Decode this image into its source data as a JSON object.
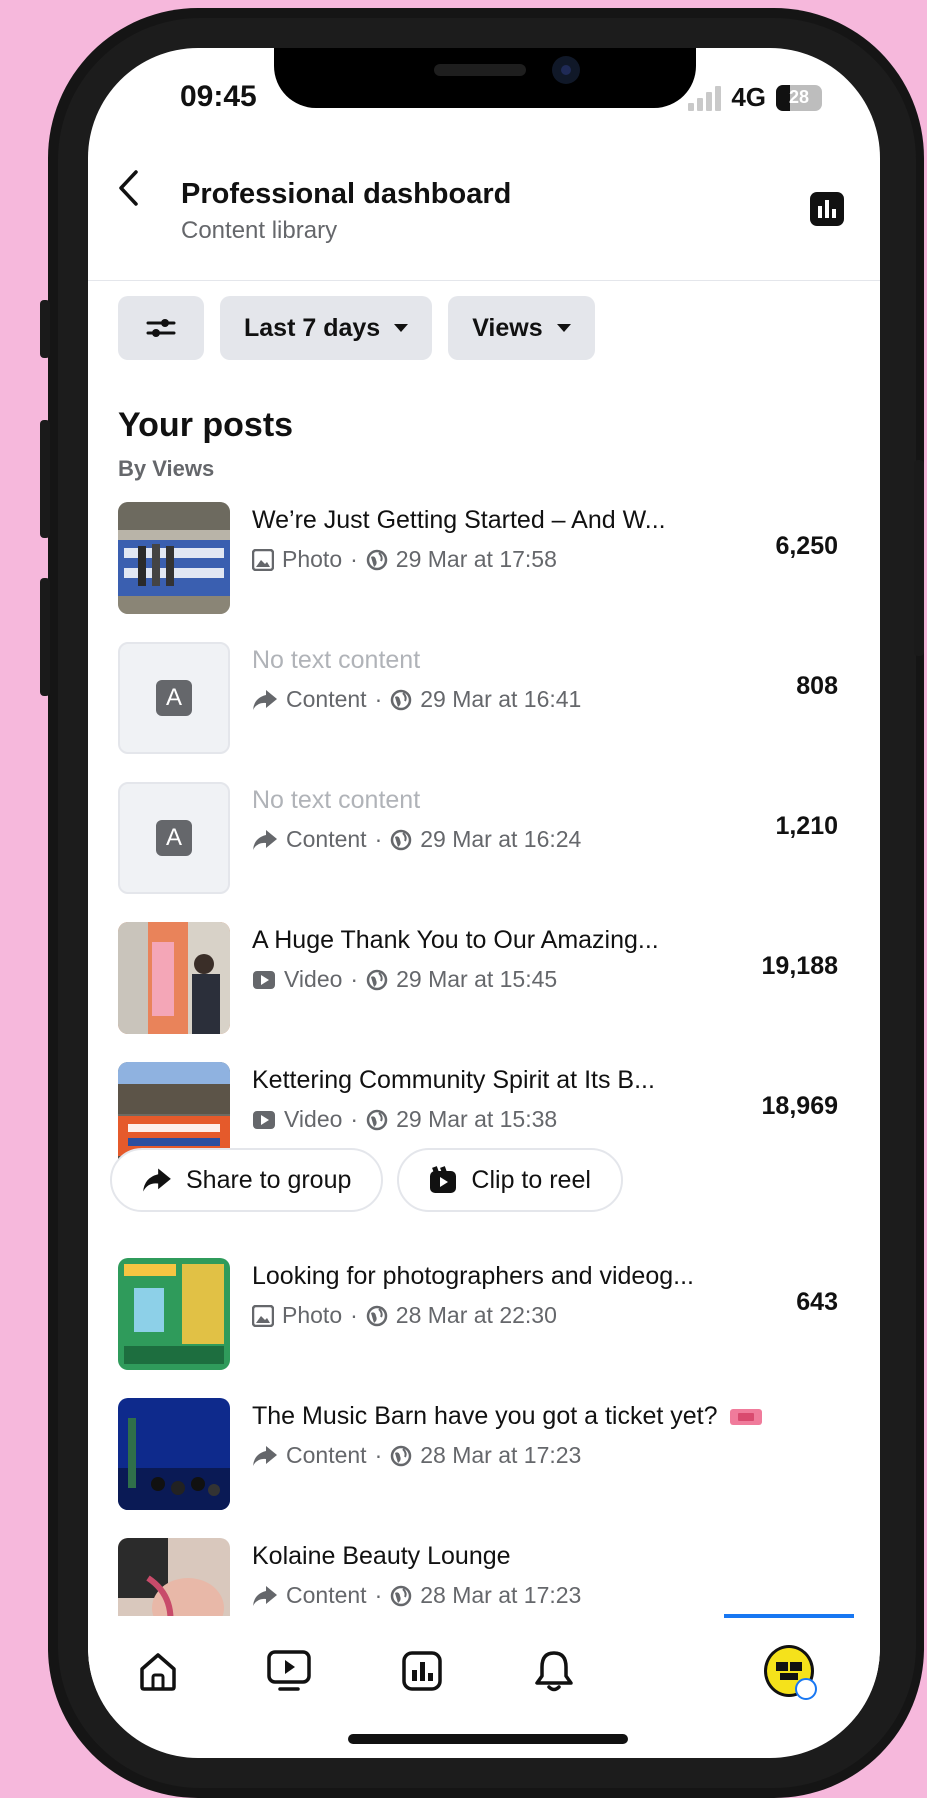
{
  "status_bar": {
    "time": "09:45",
    "network": "4G",
    "battery": "28"
  },
  "header": {
    "title": "Professional dashboard",
    "subtitle": "Content library"
  },
  "filters": {
    "date_range": "Last 7 days",
    "metric": "Views"
  },
  "section": {
    "title": "Your posts",
    "subtitle": "By Views"
  },
  "posts": [
    {
      "title": "We’re Just Getting Started – And W...",
      "type": "Photo",
      "date": "29 Mar at 17:58",
      "value": "6,250"
    },
    {
      "title": "No text content",
      "type": "Content",
      "date": "29 Mar at 16:41",
      "value": "808"
    },
    {
      "title": "No text content",
      "type": "Content",
      "date": "29 Mar at 16:24",
      "value": "1,210"
    },
    {
      "title": "A Huge Thank You to Our Amazing...",
      "type": "Video",
      "date": "29 Mar at 15:45",
      "value": "19,188"
    },
    {
      "title": "Kettering Community Spirit at Its B...",
      "type": "Video",
      "date": "29 Mar at 15:38",
      "value": "18,969"
    },
    {
      "title": "Looking for photographers and videog...",
      "type": "Photo",
      "date": "28 Mar at 22:30",
      "value": "643"
    },
    {
      "title": "The Music Barn have you got a ticket yet?",
      "type": "Content",
      "date": "28 Mar at 17:23",
      "value": ""
    },
    {
      "title": "Kolaine Beauty Lounge",
      "type": "Content",
      "date": "28 Mar at 17:23",
      "value": ""
    }
  ],
  "actions": {
    "share": "Share to group",
    "clip": "Clip to reel"
  },
  "tabs": [
    "home-icon",
    "video-icon",
    "insights-icon",
    "bell-icon",
    "profile-avatar"
  ],
  "colors": {
    "accent": "#1877f2",
    "background": "#f6b8dc"
  }
}
